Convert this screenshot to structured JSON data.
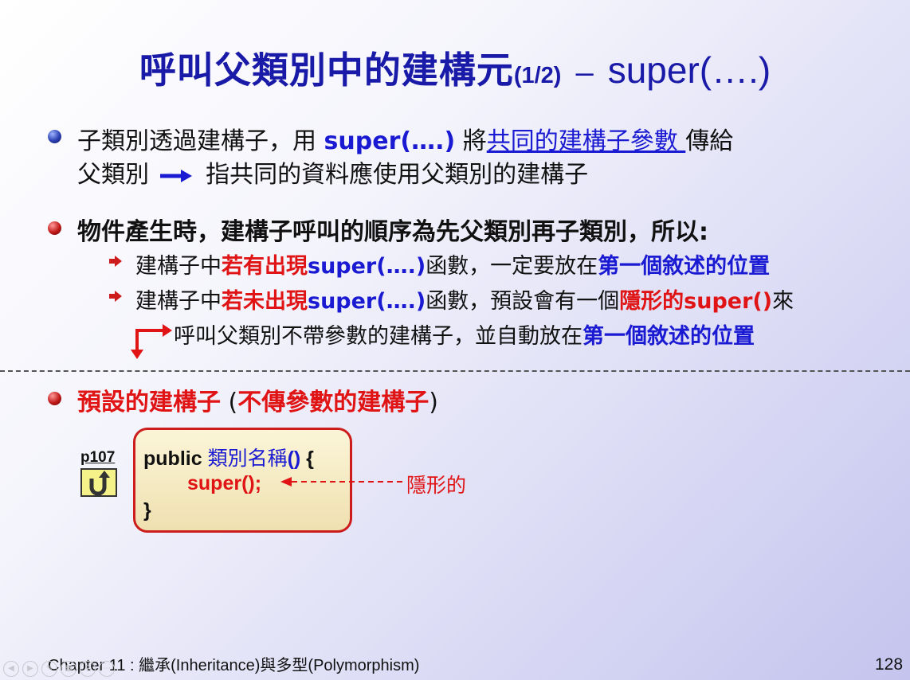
{
  "slide": {
    "title_zh": "呼叫父類別中的建構元",
    "title_num": "(1/2)",
    "title_dash": "–",
    "title_super": "super(….)"
  },
  "bullet1": {
    "line1_a": "子類別透過建構子，用 ",
    "line1_super": "super(….)",
    "line1_b": " 將",
    "line1_link": "共同的建構子參數 ",
    "line1_c": "傳給",
    "line2_a": "父類別 ",
    "line2_b": " 指共同的資料應使用父類別的建構子"
  },
  "bullet2": {
    "text": "物件產生時，建構子呼叫的順序為先父類別再子類別，所以:",
    "sub1_a": "建構子中",
    "sub1_red": "若有出現",
    "sub1_super": "super(….)",
    "sub1_b": "函數，一定要放在",
    "sub1_blue": "第一個敘述的位置",
    "sub2_a": "建構子中",
    "sub2_red": "若未出現",
    "sub2_super": "super(….)",
    "sub2_b": "函數，預設會有一個",
    "sub2_red2": "隱形的super()",
    "sub2_c": "來",
    "sub3_a": "呼叫父類別不帶參數的建構子，並自動放在",
    "sub3_blue": "第一個敘述的位置"
  },
  "bullet3": {
    "red1": "預設的建構子",
    "paren_open": " (",
    "red2": "不傳參數的建構子",
    "paren_close": ")"
  },
  "code": {
    "page_ref": "p107",
    "line1_kw": "public ",
    "line1_name": "類別名稱",
    "line1_paren": "()",
    "line1_brace": " {",
    "line2": "super();",
    "line3": "}",
    "annotation": "隱形的"
  },
  "footer": {
    "chapter": "Chapter 11 : 繼承(Inheritance)與多型(Polymorphism)",
    "page": "128"
  },
  "colors": {
    "title": "#1a1aa8",
    "blue_text": "#1a1ad2",
    "red_text": "#e01414",
    "code_border": "#cc1c1c"
  },
  "icons": [
    "bullet-ball-icon",
    "sub-arrow-icon",
    "right-arrow-icon",
    "bent-arrow-icon",
    "return-icon",
    "dashed-left-arrow-icon"
  ]
}
